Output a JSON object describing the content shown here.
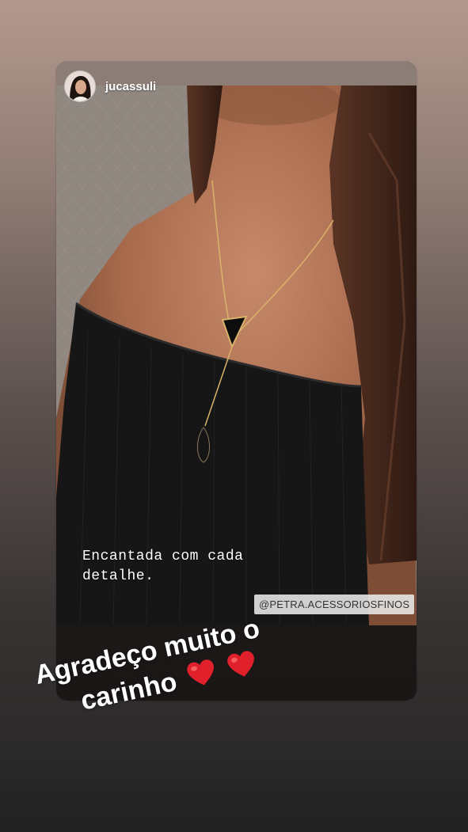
{
  "story": {
    "username": "jucassuli",
    "caption_line1": "Encantada com cada",
    "caption_line2": "detalhe.",
    "mention": "@PETRA.ACESSORIOSFINOS"
  },
  "overlay": {
    "line1": "Agradeço muito o",
    "line2": "carinho",
    "heart_icons": [
      "heart-icon",
      "heart-icon"
    ]
  },
  "colors": {
    "heart": "#e0202a",
    "top_bg": "#b3998d",
    "bottom_bg": "#222222"
  }
}
